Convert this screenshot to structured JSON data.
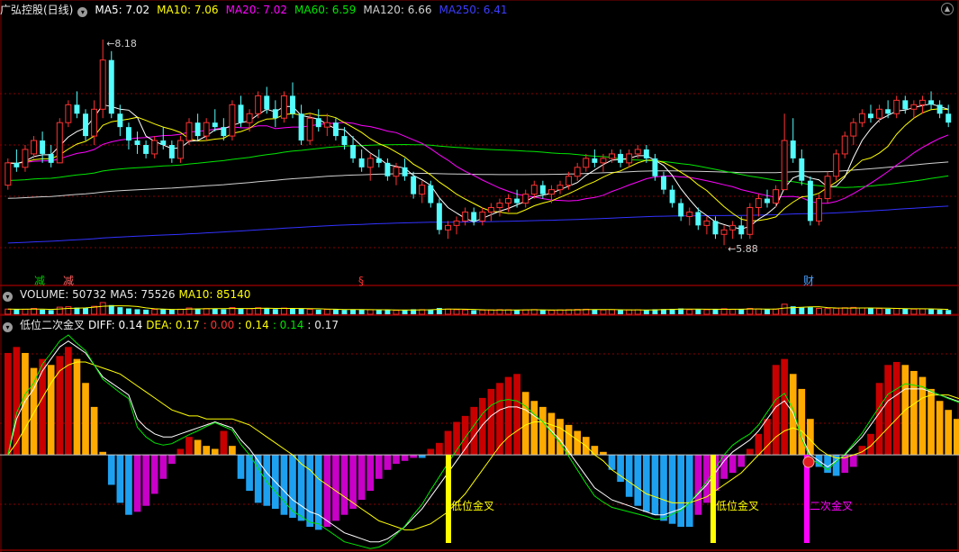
{
  "main_header": {
    "title": "广弘控股(日线)",
    "ma5": "MA5: 7.02",
    "ma10": "MA10: 7.06",
    "ma20": "MA20: 7.02",
    "ma60": "MA60: 6.59",
    "ma120": "MA120: 6.66",
    "ma250": "MA250: 6.41"
  },
  "vol_header": {
    "vol": "VOLUME: 50732",
    "ma5": "MA5: 75526",
    "ma10": "MA10: 85140"
  },
  "ind_header": {
    "title": "低位二次金叉",
    "diff": "DIFF: 0.14",
    "dea": "DEA: 0.17",
    "v1": ": 0.00",
    "v2": ": 0.14",
    "v3": ": 0.14",
    "v4": ": 0.17"
  },
  "colors": {
    "up": "#ff3232",
    "down": "#54fcfc",
    "ma5": "#ffffff",
    "ma10": "#ffff00",
    "ma20": "#ff00ff",
    "ma60": "#00e600",
    "ma120": "#d0d0d0",
    "ma250": "#3232ff",
    "grid": "#880000",
    "hist_red": "#c80000",
    "hist_orange": "#ffaa00",
    "hist_blue": "#1ea0f0",
    "hist_magenta": "#c800c8",
    "signal_yellow": "#ffff00"
  },
  "chart_data": [
    {
      "type": "candlestick",
      "title": "广弘控股(日线)",
      "price_high_label": "8.18",
      "price_low_label": "5.88",
      "event_markers": [
        "减",
        "减",
        "§",
        "财"
      ],
      "ylim": [
        5.6,
        8.4
      ],
      "ohlc": [
        [
          6.55,
          6.85,
          6.5,
          6.8
        ],
        [
          6.8,
          6.95,
          6.7,
          6.75
        ],
        [
          6.75,
          7.0,
          6.7,
          6.95
        ],
        [
          6.9,
          7.1,
          6.85,
          7.05
        ],
        [
          7.05,
          7.15,
          6.8,
          6.9
        ],
        [
          6.9,
          7.0,
          6.75,
          6.8
        ],
        [
          6.8,
          7.3,
          6.8,
          7.25
        ],
        [
          7.25,
          7.5,
          7.2,
          7.45
        ],
        [
          7.45,
          7.6,
          7.3,
          7.35
        ],
        [
          7.35,
          7.4,
          7.05,
          7.1
        ],
        [
          7.1,
          7.5,
          7.0,
          7.4
        ],
        [
          7.4,
          8.18,
          7.3,
          7.95
        ],
        [
          7.95,
          8.05,
          7.3,
          7.35
        ],
        [
          7.35,
          7.45,
          7.1,
          7.2
        ],
        [
          7.2,
          7.25,
          6.95,
          7.05
        ],
        [
          7.05,
          7.15,
          6.9,
          7.0
        ],
        [
          7.0,
          7.05,
          6.85,
          6.9
        ],
        [
          6.9,
          7.1,
          6.85,
          7.05
        ],
        [
          7.05,
          7.2,
          6.95,
          7.0
        ],
        [
          7.0,
          7.05,
          6.8,
          6.85
        ],
        [
          6.85,
          7.1,
          6.8,
          7.05
        ],
        [
          7.05,
          7.3,
          7.0,
          7.25
        ],
        [
          7.25,
          7.35,
          7.05,
          7.1
        ],
        [
          7.1,
          7.3,
          7.05,
          7.25
        ],
        [
          7.25,
          7.4,
          7.15,
          7.2
        ],
        [
          7.2,
          7.3,
          7.05,
          7.1
        ],
        [
          7.1,
          7.5,
          7.05,
          7.45
        ],
        [
          7.45,
          7.55,
          7.2,
          7.25
        ],
        [
          7.25,
          7.4,
          7.15,
          7.35
        ],
        [
          7.35,
          7.6,
          7.3,
          7.55
        ],
        [
          7.55,
          7.65,
          7.35,
          7.4
        ],
        [
          7.4,
          7.5,
          7.2,
          7.3
        ],
        [
          7.3,
          7.6,
          7.25,
          7.55
        ],
        [
          7.55,
          7.7,
          7.3,
          7.35
        ],
        [
          7.35,
          7.45,
          7.0,
          7.05
        ],
        [
          7.05,
          7.35,
          7.0,
          7.3
        ],
        [
          7.3,
          7.4,
          7.15,
          7.2
        ],
        [
          7.2,
          7.35,
          7.1,
          7.25
        ],
        [
          7.25,
          7.3,
          7.05,
          7.1
        ],
        [
          7.1,
          7.2,
          6.95,
          7.0
        ],
        [
          7.0,
          7.1,
          6.8,
          6.85
        ],
        [
          6.85,
          6.95,
          6.7,
          6.75
        ],
        [
          6.75,
          6.9,
          6.6,
          6.85
        ],
        [
          6.85,
          6.95,
          6.75,
          6.8
        ],
        [
          6.8,
          6.85,
          6.6,
          6.65
        ],
        [
          6.65,
          6.8,
          6.55,
          6.75
        ],
        [
          6.75,
          6.85,
          6.6,
          6.65
        ],
        [
          6.65,
          6.7,
          6.4,
          6.45
        ],
        [
          6.45,
          6.6,
          6.35,
          6.55
        ],
        [
          6.55,
          6.6,
          6.3,
          6.35
        ],
        [
          6.35,
          6.4,
          6.0,
          6.05
        ],
        [
          6.05,
          6.15,
          5.95,
          6.1
        ],
        [
          6.1,
          6.2,
          6.0,
          6.15
        ],
        [
          6.15,
          6.3,
          6.1,
          6.25
        ],
        [
          6.25,
          6.3,
          6.1,
          6.15
        ],
        [
          6.15,
          6.3,
          6.1,
          6.25
        ],
        [
          6.25,
          6.35,
          6.15,
          6.3
        ],
        [
          6.3,
          6.4,
          6.2,
          6.35
        ],
        [
          6.35,
          6.45,
          6.25,
          6.4
        ],
        [
          6.4,
          6.5,
          6.3,
          6.35
        ],
        [
          6.35,
          6.5,
          6.3,
          6.45
        ],
        [
          6.45,
          6.6,
          6.4,
          6.55
        ],
        [
          6.55,
          6.6,
          6.4,
          6.45
        ],
        [
          6.45,
          6.55,
          6.35,
          6.5
        ],
        [
          6.5,
          6.6,
          6.45,
          6.55
        ],
        [
          6.55,
          6.7,
          6.5,
          6.65
        ],
        [
          6.65,
          6.8,
          6.6,
          6.75
        ],
        [
          6.75,
          6.9,
          6.7,
          6.85
        ],
        [
          6.85,
          6.95,
          6.75,
          6.8
        ],
        [
          6.8,
          6.9,
          6.7,
          6.85
        ],
        [
          6.85,
          6.95,
          6.8,
          6.9
        ],
        [
          6.9,
          6.95,
          6.75,
          6.8
        ],
        [
          6.8,
          6.95,
          6.75,
          6.9
        ],
        [
          6.9,
          7.0,
          6.85,
          6.95
        ],
        [
          6.95,
          7.0,
          6.8,
          6.85
        ],
        [
          6.85,
          6.9,
          6.6,
          6.65
        ],
        [
          6.65,
          6.7,
          6.45,
          6.5
        ],
        [
          6.5,
          6.55,
          6.3,
          6.35
        ],
        [
          6.35,
          6.4,
          6.15,
          6.2
        ],
        [
          6.2,
          6.3,
          6.1,
          6.25
        ],
        [
          6.25,
          6.3,
          6.05,
          6.1
        ],
        [
          6.1,
          6.2,
          6.0,
          6.15
        ],
        [
          6.15,
          6.2,
          5.95,
          6.0
        ],
        [
          6.0,
          6.1,
          5.88,
          6.05
        ],
        [
          6.05,
          6.15,
          5.95,
          6.1
        ],
        [
          6.1,
          6.2,
          5.95,
          6.0
        ],
        [
          6.0,
          6.35,
          5.95,
          6.3
        ],
        [
          6.3,
          6.45,
          6.2,
          6.4
        ],
        [
          6.4,
          6.5,
          6.3,
          6.35
        ],
        [
          6.35,
          6.55,
          6.3,
          6.5
        ],
        [
          6.5,
          7.35,
          6.5,
          7.05
        ],
        [
          7.05,
          7.3,
          6.8,
          6.85
        ],
        [
          6.85,
          6.95,
          6.55,
          6.6
        ],
        [
          6.6,
          6.65,
          6.1,
          6.15
        ],
        [
          6.15,
          6.45,
          6.1,
          6.4
        ],
        [
          6.4,
          6.7,
          6.35,
          6.65
        ],
        [
          6.65,
          6.95,
          6.6,
          6.9
        ],
        [
          6.9,
          7.15,
          6.85,
          7.1
        ],
        [
          7.1,
          7.3,
          7.0,
          7.25
        ],
        [
          7.25,
          7.4,
          7.2,
          7.35
        ],
        [
          7.35,
          7.45,
          7.25,
          7.3
        ],
        [
          7.3,
          7.45,
          7.25,
          7.4
        ],
        [
          7.4,
          7.5,
          7.3,
          7.35
        ],
        [
          7.35,
          7.55,
          7.3,
          7.5
        ],
        [
          7.5,
          7.55,
          7.35,
          7.4
        ],
        [
          7.4,
          7.5,
          7.3,
          7.45
        ],
        [
          7.45,
          7.55,
          7.35,
          7.5
        ],
        [
          7.5,
          7.6,
          7.4,
          7.45
        ],
        [
          7.45,
          7.5,
          7.3,
          7.35
        ],
        [
          7.35,
          7.45,
          7.2,
          7.25
        ]
      ]
    },
    {
      "type": "bar",
      "title": "VOLUME",
      "values": [
        62,
        58,
        60,
        70,
        55,
        50,
        85,
        90,
        80,
        75,
        95,
        140,
        110,
        85,
        70,
        60,
        55,
        58,
        62,
        55,
        60,
        75,
        70,
        68,
        65,
        60,
        80,
        72,
        66,
        78,
        70,
        62,
        74,
        68,
        72,
        60,
        55,
        58,
        56,
        52,
        60,
        55,
        54,
        50,
        52,
        48,
        50,
        60,
        55,
        58,
        75,
        62,
        55,
        52,
        48,
        50,
        52,
        55,
        54,
        50,
        52,
        56,
        50,
        48,
        52,
        55,
        58,
        60,
        54,
        52,
        55,
        50,
        52,
        54,
        50,
        60,
        62,
        65,
        70,
        55,
        58,
        55,
        62,
        66,
        58,
        60,
        70,
        64,
        58,
        62,
        120,
        95,
        80,
        85,
        70,
        68,
        72,
        78,
        82,
        75,
        70,
        68,
        65,
        70,
        66,
        62,
        64,
        60,
        55,
        51
      ]
    },
    {
      "type": "bar",
      "title": "低位二次金叉",
      "labels": [
        "低位金叉",
        "低位金叉",
        "二次金叉"
      ],
      "zero_line": 0,
      "ylim": [
        -0.3,
        0.4
      ],
      "histogram": [
        0.34,
        0.36,
        0.34,
        0.29,
        0.32,
        0.3,
        0.33,
        0.36,
        0.32,
        0.24,
        0.16,
        0.01,
        -0.1,
        -0.16,
        -0.2,
        -0.19,
        -0.17,
        -0.13,
        -0.08,
        -0.03,
        0.02,
        0.06,
        0.05,
        0.03,
        0.02,
        0.08,
        0.03,
        -0.08,
        -0.12,
        -0.16,
        -0.17,
        -0.18,
        -0.2,
        -0.21,
        -0.22,
        -0.24,
        -0.25,
        -0.24,
        -0.22,
        -0.2,
        -0.18,
        -0.15,
        -0.12,
        -0.08,
        -0.05,
        -0.03,
        -0.02,
        -0.01,
        -0.01,
        0.02,
        0.04,
        0.08,
        0.11,
        0.13,
        0.16,
        0.19,
        0.22,
        0.24,
        0.26,
        0.27,
        0.21,
        0.18,
        0.16,
        0.14,
        0.12,
        0.1,
        0.08,
        0.06,
        0.03,
        0.01,
        -0.05,
        -0.09,
        -0.14,
        -0.17,
        -0.19,
        -0.2,
        -0.22,
        -0.23,
        -0.24,
        -0.24,
        -0.2,
        -0.16,
        -0.12,
        -0.08,
        -0.06,
        -0.04,
        0.02,
        0.07,
        0.12,
        0.3,
        0.32,
        0.27,
        0.22,
        0.12,
        -0.04,
        -0.06,
        -0.07,
        -0.06,
        -0.04,
        0.03,
        0.07,
        0.24,
        0.3,
        0.31,
        0.3,
        0.28,
        0.26,
        0.22,
        0.18,
        0.15,
        0.12,
        0.1,
        0.08,
        0.06,
        0.03
      ],
      "diff": [
        0.0,
        0.12,
        0.18,
        0.22,
        0.28,
        0.32,
        0.36,
        0.38,
        0.36,
        0.34,
        0.3,
        0.26,
        0.24,
        0.22,
        0.2,
        0.12,
        0.09,
        0.07,
        0.06,
        0.06,
        0.07,
        0.08,
        0.09,
        0.1,
        0.11,
        0.1,
        0.09,
        0.05,
        0.02,
        -0.02,
        -0.06,
        -0.09,
        -0.12,
        -0.15,
        -0.17,
        -0.19,
        -0.2,
        -0.22,
        -0.24,
        -0.26,
        -0.27,
        -0.28,
        -0.29,
        -0.29,
        -0.28,
        -0.26,
        -0.24,
        -0.21,
        -0.18,
        -0.14,
        -0.1,
        -0.06,
        -0.02,
        0.02,
        0.06,
        0.1,
        0.13,
        0.15,
        0.16,
        0.16,
        0.15,
        0.13,
        0.11,
        0.08,
        0.05,
        0.01,
        -0.03,
        -0.07,
        -0.11,
        -0.13,
        -0.15,
        -0.16,
        -0.17,
        -0.18,
        -0.19,
        -0.2,
        -0.2,
        -0.19,
        -0.18,
        -0.16,
        -0.13,
        -0.1,
        -0.06,
        -0.02,
        0.01,
        0.03,
        0.05,
        0.08,
        0.12,
        0.16,
        0.18,
        0.14,
        0.06,
        0.0,
        -0.02,
        -0.04,
        -0.02,
        0.0,
        0.03,
        0.06,
        0.1,
        0.14,
        0.18,
        0.2,
        0.22,
        0.22,
        0.22,
        0.21,
        0.2,
        0.19,
        0.18,
        0.17,
        0.16,
        0.15,
        0.14
      ],
      "dea": [
        0.0,
        0.04,
        0.09,
        0.14,
        0.19,
        0.24,
        0.28,
        0.3,
        0.31,
        0.31,
        0.3,
        0.29,
        0.28,
        0.27,
        0.25,
        0.23,
        0.21,
        0.19,
        0.17,
        0.15,
        0.14,
        0.13,
        0.13,
        0.12,
        0.12,
        0.12,
        0.12,
        0.11,
        0.1,
        0.08,
        0.06,
        0.04,
        0.02,
        0.0,
        -0.03,
        -0.05,
        -0.08,
        -0.1,
        -0.12,
        -0.14,
        -0.16,
        -0.18,
        -0.2,
        -0.22,
        -0.23,
        -0.24,
        -0.25,
        -0.25,
        -0.24,
        -0.23,
        -0.21,
        -0.19,
        -0.16,
        -0.13,
        -0.09,
        -0.05,
        -0.01,
        0.03,
        0.06,
        0.08,
        0.1,
        0.11,
        0.11,
        0.1,
        0.09,
        0.07,
        0.05,
        0.03,
        0.0,
        -0.02,
        -0.05,
        -0.07,
        -0.09,
        -0.11,
        -0.13,
        -0.14,
        -0.15,
        -0.16,
        -0.16,
        -0.16,
        -0.15,
        -0.14,
        -0.12,
        -0.1,
        -0.08,
        -0.06,
        -0.03,
        0.0,
        0.03,
        0.06,
        0.08,
        0.09,
        0.08,
        0.05,
        0.02,
        0.0,
        -0.01,
        -0.01,
        0.0,
        0.01,
        0.03,
        0.06,
        0.09,
        0.12,
        0.15,
        0.17,
        0.19,
        0.2,
        0.2,
        0.2,
        0.19,
        0.18,
        0.17,
        0.17,
        0.17
      ]
    }
  ]
}
